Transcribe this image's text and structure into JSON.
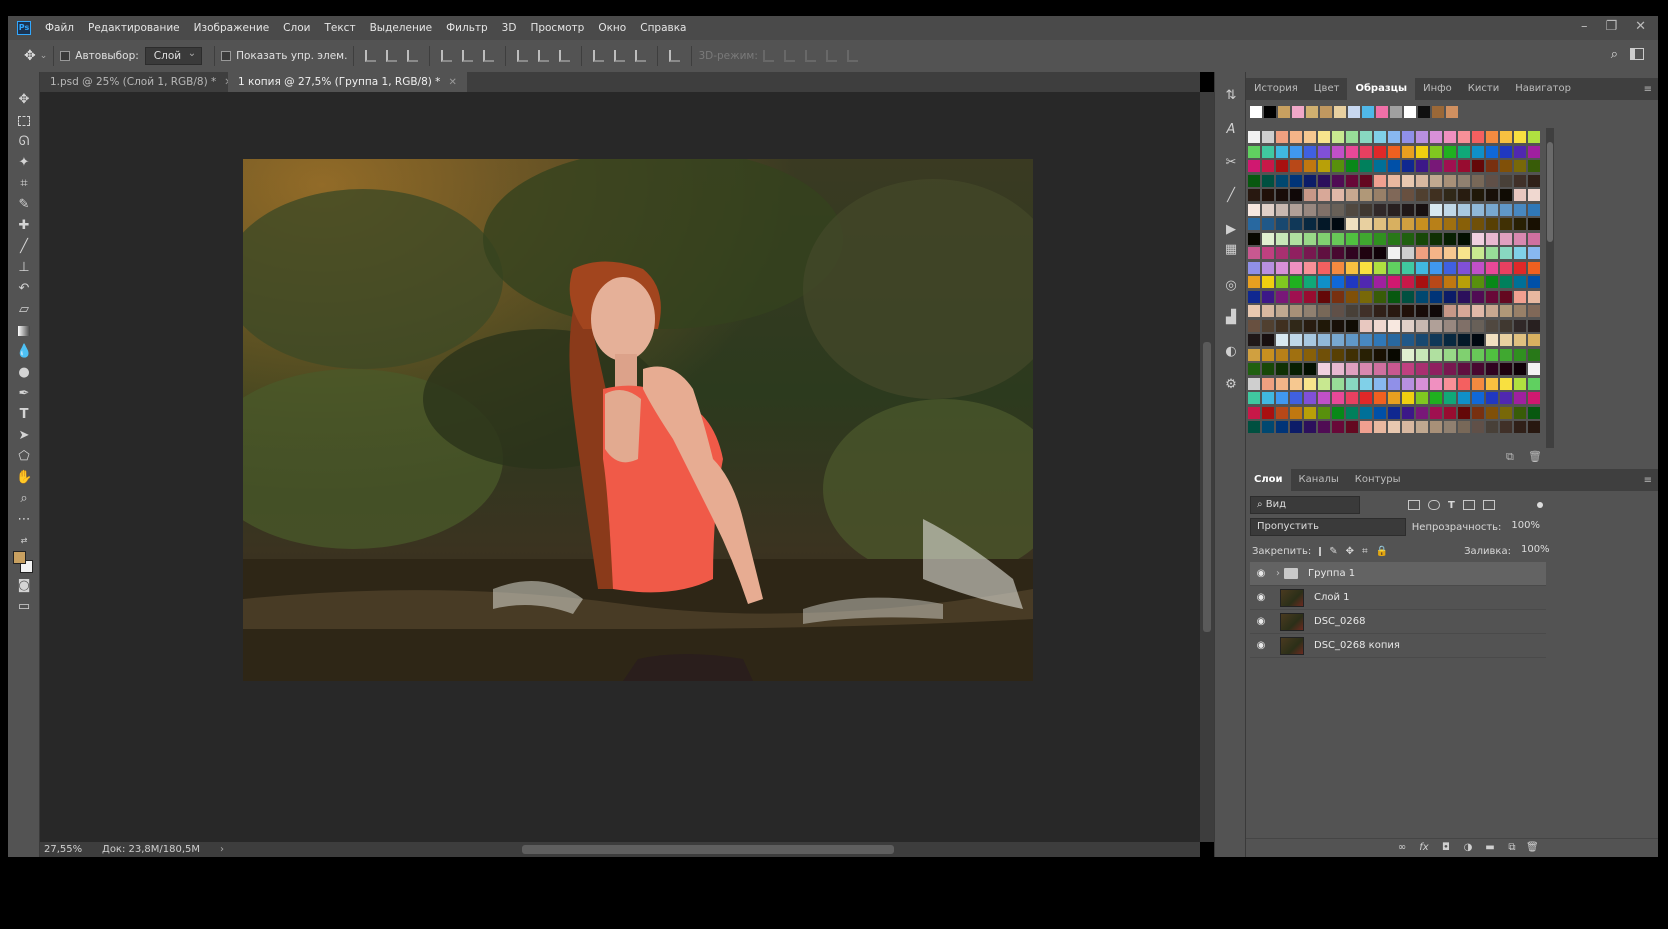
{
  "menubar": {
    "logo": "Ps",
    "items": [
      "Файл",
      "Редактирование",
      "Изображение",
      "Слои",
      "Текст",
      "Выделение",
      "Фильтр",
      "3D",
      "Просмотр",
      "Окно",
      "Справка"
    ]
  },
  "options_bar": {
    "autoselect_label": "Автовыбор:",
    "autoselect_value": "Слой",
    "show_controls_label": "Показать упр. элем.",
    "mode_3d_label": "3D-режим:"
  },
  "document_tabs": [
    {
      "label": "1.psd @ 25% (Слой 1, RGB/8) *",
      "active": false
    },
    {
      "label": "1 копия @ 27,5% (Группа 1, RGB/8) *",
      "active": true
    }
  ],
  "status": {
    "zoom": "27,55%",
    "doc": "Док: 23,8M/180,5M"
  },
  "swatches_panel": {
    "tabs": [
      "История",
      "Цвет",
      "Образцы",
      "Инфо",
      "Кисти",
      "Навигатор"
    ],
    "active_tab": "Образцы",
    "recent": [
      "#ffffff",
      "#000000",
      "#c8a060",
      "#f0a8c8",
      "#d0b070",
      "#c09860",
      "#e8d0a0",
      "#c8d8f0",
      "#50b8e8",
      "#f070a8",
      "#a0a0a0",
      "#ffffff",
      "#101010",
      "#9a6838",
      "#d09060"
    ],
    "palette": [
      "#f2f2f2",
      "#cfcfcf",
      "#f0a080",
      "#f4b488",
      "#f6c890",
      "#f8e48c",
      "#c8e890",
      "#98dc98",
      "#88d8c0",
      "#80d0e8",
      "#88b8f0",
      "#9090e8",
      "#b890e0",
      "#d890d8",
      "#f090c0",
      "#f89098",
      "#f46060",
      "#f48a40",
      "#f8c040",
      "#f8e040",
      "#b0e040",
      "#60d060",
      "#40c8a0",
      "#40b8e0",
      "#4098f0",
      "#4060e0",
      "#8050d8",
      "#c050c8",
      "#e84898",
      "#e84060",
      "#e02828",
      "#f06020",
      "#e8a020",
      "#f0d010",
      "#80c820",
      "#20b020",
      "#10a878",
      "#1090c8",
      "#1068d8",
      "#2038c0",
      "#5028b0",
      "#a020a0",
      "#d01870",
      "#c81848",
      "#a81010",
      "#b84818",
      "#c07810",
      "#b8a008",
      "#58900c",
      "#088818",
      "#00805c",
      "#007098",
      "#0050a8",
      "#102890",
      "#3c1888",
      "#781878",
      "#a01050",
      "#980c30",
      "#640808",
      "#783010",
      "#805008",
      "#786808",
      "#385c08",
      "#085810",
      "#005040",
      "#004870",
      "#003478",
      "#0c1c68",
      "#2c105c",
      "#500c54",
      "#680838",
      "#640820",
      "#f0a090",
      "#e8b8a0",
      "#e8c8b0",
      "#d8b8a0",
      "#c0a890",
      "#a89078",
      "#908070",
      "#786858",
      "#605048",
      "#484038",
      "#403028",
      "#302018",
      "#281810",
      "#201008",
      "#180c08",
      "#100808",
      "#c89888",
      "#d8a898",
      "#e0b8a8",
      "#c8a890",
      "#b09878",
      "#988068",
      "#806858",
      "#685040",
      "#504030",
      "#403020",
      "#302818",
      "#281c10",
      "#201808",
      "#181008",
      "#100c04",
      "#e8c8c0",
      "#f0d8d0",
      "#f8e8e0",
      "#e0d0c8",
      "#c8b8b0",
      "#b0a098",
      "#988880",
      "#807068",
      "#686058",
      "#504840",
      "#403830",
      "#302828",
      "#282020",
      "#201818",
      "#181010",
      "#d8e8f0",
      "#c0d8e8",
      "#a8c8e0",
      "#90b8d8",
      "#78a8d0",
      "#6098c8",
      "#4888c0",
      "#3078b8",
      "#2868a0",
      "#205888",
      "#184870",
      "#103858",
      "#082840",
      "#041828",
      "#000810",
      "#f0e0c0",
      "#e8d0a0",
      "#e0c080",
      "#d8b060",
      "#d0a040",
      "#c89020",
      "#b88018",
      "#a07010",
      "#886008",
      "#705008",
      "#584004",
      "#403004",
      "#282004",
      "#181002",
      "#080800",
      "#e0f0d0",
      "#c8e8b8",
      "#b0e0a0",
      "#98d888",
      "#80d070",
      "#68c858",
      "#50c040",
      "#40a830",
      "#309020",
      "#287818",
      "#206010",
      "#184808",
      "#103004",
      "#082002",
      "#041001",
      "#f0d0e0",
      "#e8b8d0",
      "#e0a0c0",
      "#d888b0",
      "#d070a0",
      "#c85890",
      "#c04080",
      "#a83070",
      "#902060",
      "#781850",
      "#601040",
      "#480830",
      "#300420",
      "#200210",
      "#100108"
    ],
    "palette_rows": 21
  },
  "layers_panel": {
    "tabs": [
      "Слои",
      "Каналы",
      "Контуры"
    ],
    "active_tab": "Слои",
    "filter_label": "Вид",
    "blend_mode": "Пропустить",
    "opacity_label": "Непрозрачность:",
    "opacity_value": "100%",
    "lock_label": "Закрепить:",
    "fill_label": "Заливка:",
    "fill_value": "100%",
    "layers": [
      {
        "name": "Группа 1",
        "type": "group",
        "selected": true
      },
      {
        "name": "Слой 1",
        "type": "layer",
        "selected": false
      },
      {
        "name": "DSC_0268",
        "type": "layer",
        "selected": false
      },
      {
        "name": "DSC_0268 копия",
        "type": "layer",
        "selected": false
      }
    ]
  },
  "icons": {
    "move": "move-icon",
    "marquee": "marquee-icon",
    "lasso": "lasso-icon",
    "magic": "magic-wand-icon",
    "crop": "crop-icon",
    "eyedropper": "eyedropper-icon",
    "heal": "healing-icon",
    "brush": "brush-icon",
    "stamp": "stamp-icon",
    "history_brush": "history-brush-icon",
    "eraser": "eraser-icon",
    "gradient": "gradient-icon",
    "blur": "blur-icon",
    "dodge": "dodge-icon",
    "pen": "pen-icon",
    "type": "type-icon",
    "path": "path-select-icon",
    "shape": "shape-icon",
    "hand": "hand-icon",
    "zoom": "zoom-icon"
  }
}
